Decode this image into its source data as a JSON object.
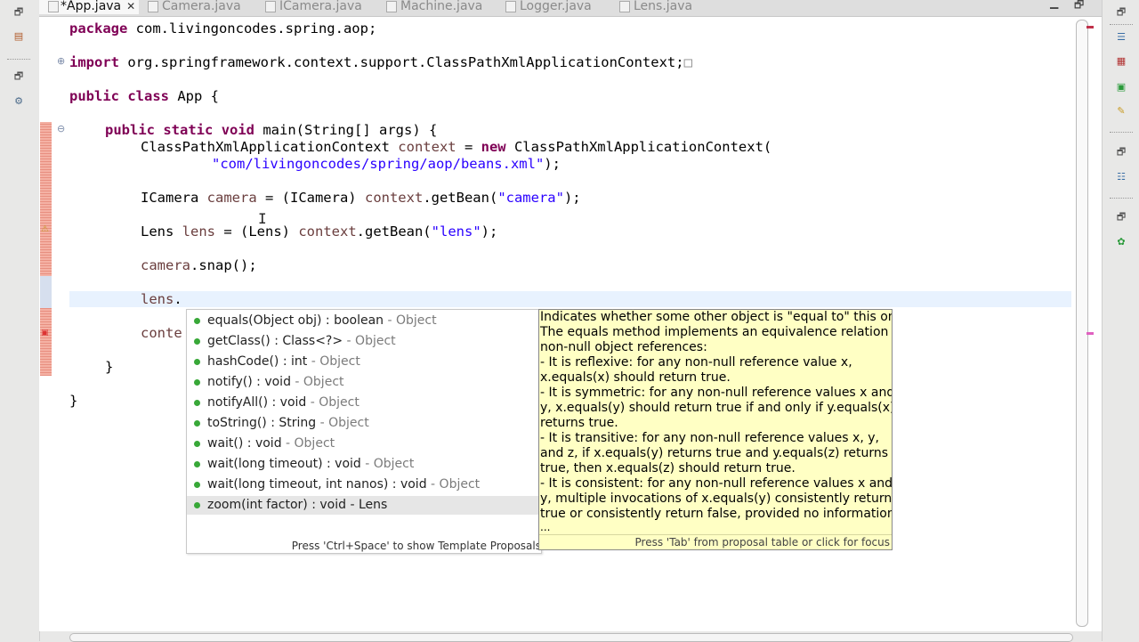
{
  "tabs": [
    {
      "label": "*App.java",
      "active": true
    },
    {
      "label": "Camera.java"
    },
    {
      "label": "ICamera.java"
    },
    {
      "label": "Machine.java"
    },
    {
      "label": "Logger.java"
    },
    {
      "label": "Lens.java"
    }
  ],
  "code": {
    "line1": {
      "kw": "package",
      "rest": " com.livingoncodes.spring.aop;"
    },
    "line2": {
      "kw": "import",
      "rest": " org.springframework.context.support.ClassPathXmlApplicationContext;",
      "collapsed_marker": "□"
    },
    "line3": {
      "kw1": "public",
      "kw2": "class",
      "rest": " App {"
    },
    "line4": {
      "kw1": "public",
      "kw2": "static",
      "kw3": "void",
      "rest": " main(String[] args) {"
    },
    "line5": {
      "type": "ClassPathXmlApplicationContext ",
      "var": "context",
      "eq": " = ",
      "kw": "new",
      "rest": " ClassPathXmlApplicationContext("
    },
    "line6": {
      "str": "\"com/livingoncodes/spring/aop/beans.xml\"",
      "rest": ");"
    },
    "line7": {
      "type": "ICamera ",
      "var": "camera",
      "mid": " = (ICamera) ",
      "var2": "context",
      "call": ".getBean(",
      "str": "\"camera\"",
      "end": ");"
    },
    "line8": {
      "type": "Lens ",
      "var": "lens",
      "mid": " = (Lens) ",
      "var2": "context",
      "call": ".getBean(",
      "str": "\"lens\"",
      "end": ");"
    },
    "line9": {
      "var": "camera",
      "rest": ".snap();"
    },
    "line10": {
      "var": "lens",
      "rest": "."
    },
    "line11": {
      "var": "conte"
    },
    "line12": "}",
    "line13": "}"
  },
  "completion": {
    "proposals": [
      {
        "sig": "equals(Object obj) : boolean",
        "owner": " - Object"
      },
      {
        "sig": "getClass() : Class<?>",
        "owner": " - Object"
      },
      {
        "sig": "hashCode() : int",
        "owner": " - Object"
      },
      {
        "sig": "notify() : void",
        "owner": " - Object"
      },
      {
        "sig": "notifyAll() : void",
        "owner": " - Object"
      },
      {
        "sig": "toString() : String",
        "owner": " - Object"
      },
      {
        "sig": "wait() : void",
        "owner": " - Object"
      },
      {
        "sig": "wait(long timeout) : void",
        "owner": " - Object"
      },
      {
        "sig": "wait(long timeout, int nanos) : void",
        "owner": " - Object"
      },
      {
        "sig": "zoom(int factor) : void - Lens",
        "owner": ""
      }
    ],
    "footer": "Press 'Ctrl+Space' to show Template Proposals"
  },
  "doc": {
    "lines": [
      "Indicates whether some other object is \"equal to\" this one.",
      "The equals method implements an equivalence relation on",
      " non-null object references:",
      "   - It is reflexive: for any non-null reference value x,",
      "     x.equals(x) should return true.",
      "   - It is symmetric: for any non-null reference values x and",
      "     y, x.equals(y) should return true if and only if y.equals(x)",
      "     returns true.",
      "   - It is transitive: for any non-null reference values x, y,",
      "     and z, if x.equals(y) returns true and y.equals(z) returns",
      "     true, then x.equals(z) should return true.",
      "   - It is consistent: for any non-null reference values x and",
      "     y, multiple invocations of x.equals(y) consistently return",
      "     true or consistently return false, provided no information",
      "..."
    ],
    "footer": "Press 'Tab' from proposal table or click for focus"
  },
  "colors": {
    "keyword": "#7f0055",
    "string": "#2a00ff",
    "variable": "#6a3e3e",
    "doc_bg": "#ffffc4",
    "proposal_icon": "#38a838"
  }
}
